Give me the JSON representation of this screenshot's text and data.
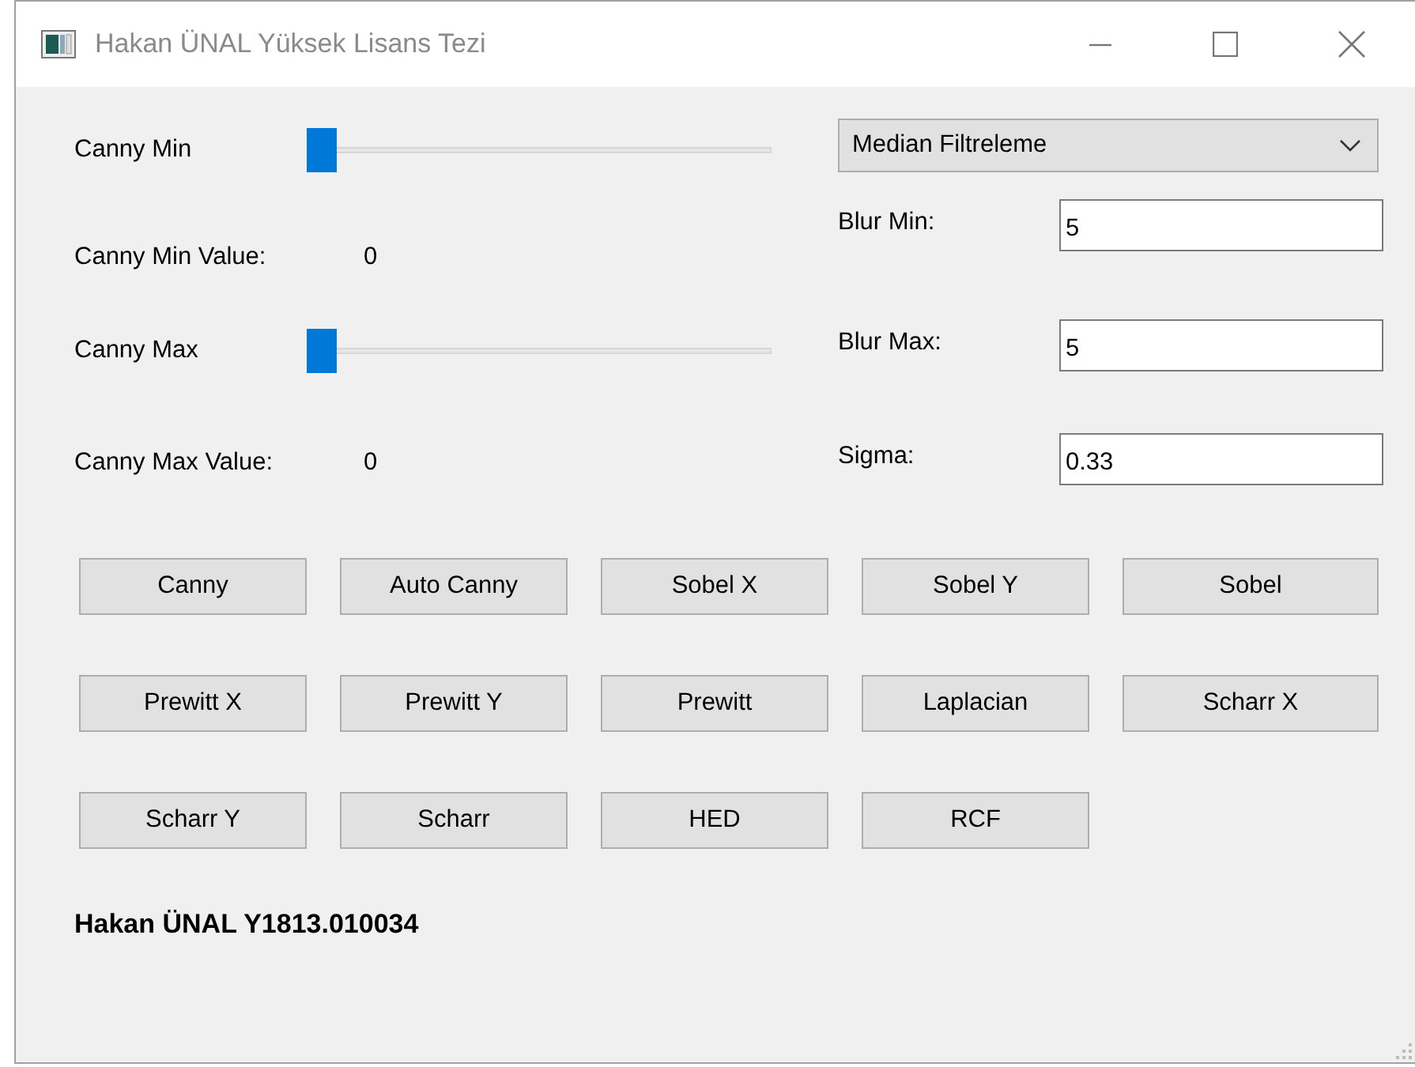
{
  "window": {
    "title": "Hakan ÜNAL Yüksek Lisans Tezi"
  },
  "canny": [
    {
      "label": "Canny Min",
      "level": 0,
      "value_label": "Canny Min Value:",
      "value": "0"
    },
    {
      "label": "Canny Max",
      "level": 0,
      "value_label": "Canny Max Value:",
      "value": "0"
    }
  ],
  "filter_dropdown": {
    "value": "Median Filtreleme"
  },
  "fields": [
    {
      "label": "Blur Min:",
      "value": "5"
    },
    {
      "label": "Blur Max:",
      "value": "5"
    },
    {
      "label": "Sigma:",
      "value": "0.33"
    }
  ],
  "buttons": [
    [
      "Canny",
      "Auto Canny",
      "Sobel X",
      "Sobel Y",
      "Sobel"
    ],
    [
      "Prewitt X",
      "Prewitt Y",
      "Prewitt",
      "Laplacian",
      "Scharr X"
    ],
    [
      "Scharr Y",
      "Scharr",
      "HED",
      "RCF"
    ]
  ],
  "footer": "Hakan ÜNAL Y1813.010034"
}
